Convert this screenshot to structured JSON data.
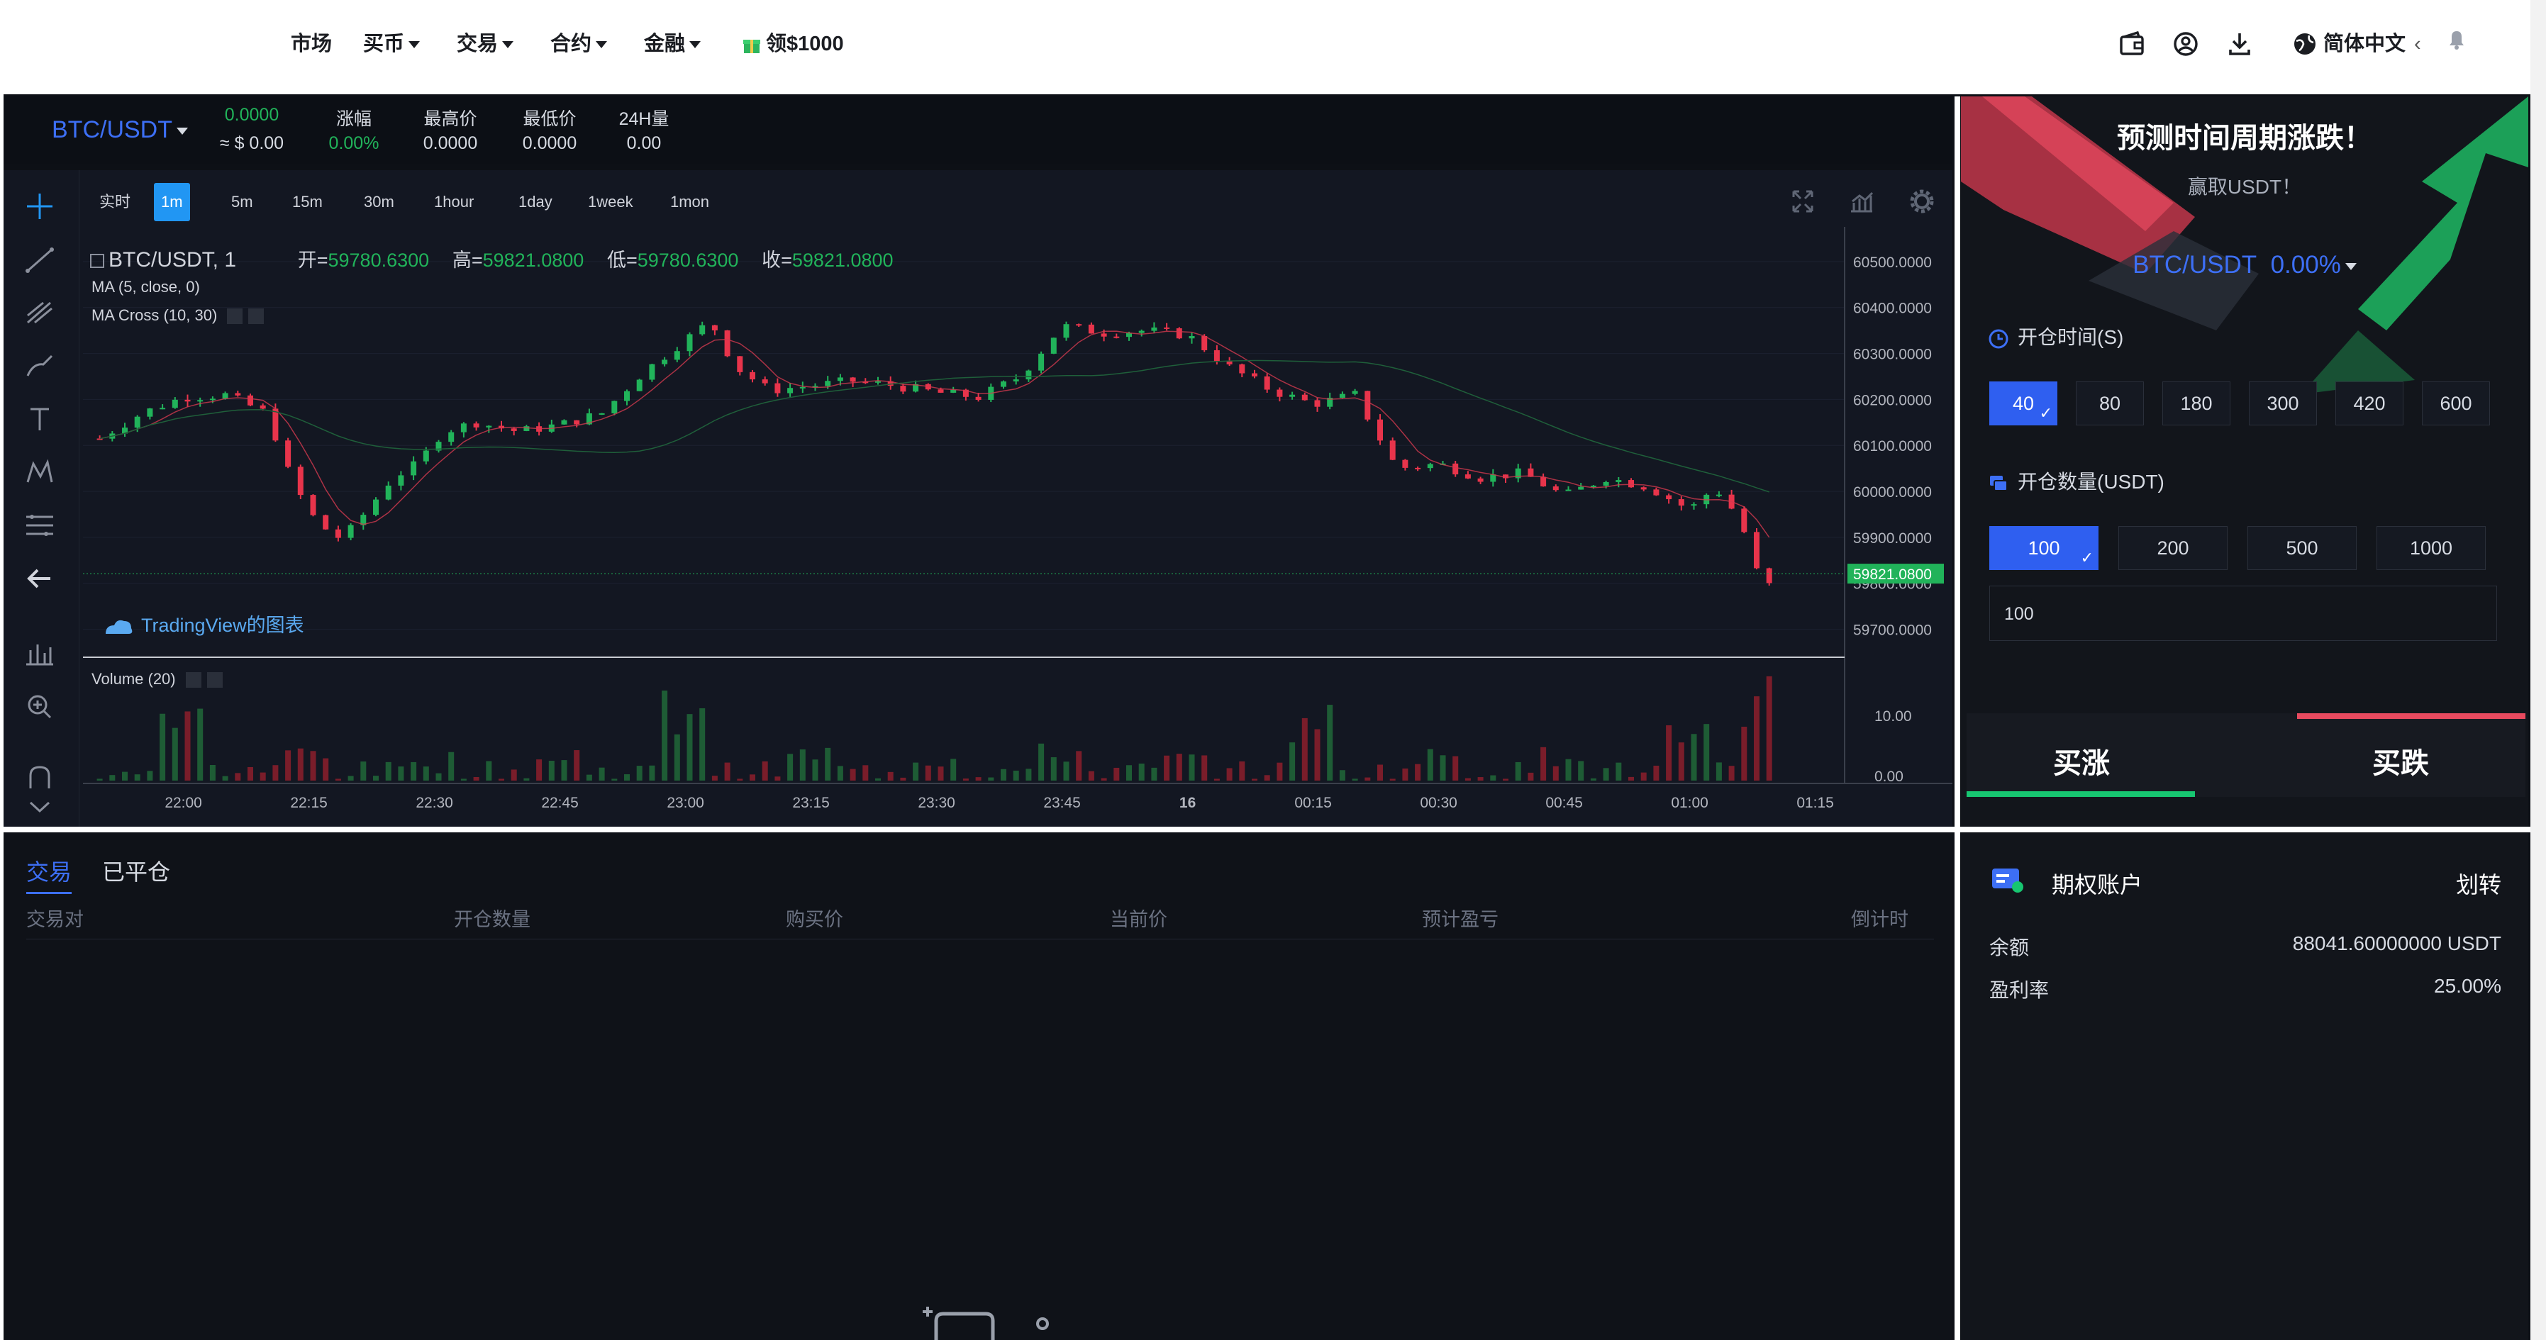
{
  "nav": {
    "items": [
      {
        "label": "市场",
        "dropdown": false
      },
      {
        "label": "买币",
        "dropdown": true
      },
      {
        "label": "交易",
        "dropdown": true
      },
      {
        "label": "合约",
        "dropdown": true
      },
      {
        "label": "金融",
        "dropdown": true
      }
    ],
    "promo_label": "领$1000",
    "language_label": "简体中文",
    "language_arrow": "‹",
    "icons": [
      "wallet-icon",
      "user-icon",
      "download-icon",
      "globe-icon",
      "bell-icon"
    ]
  },
  "ticker": {
    "pair": "BTC/USDT",
    "last_price": "0.0000",
    "last_price_usd": "≈ $ 0.00",
    "change_label": "涨幅",
    "change_value": "0.00%",
    "high_label": "最高价",
    "high_value": "0.0000",
    "low_label": "最低价",
    "low_value": "0.0000",
    "volume_label": "24H量",
    "volume_value": "0.00"
  },
  "chart": {
    "intervals": [
      "实时",
      "1m",
      "5m",
      "15m",
      "30m",
      "1hour",
      "1day",
      "1week",
      "1mon"
    ],
    "active_interval": "1m",
    "legend_symbol": "BTC/USDT, 1",
    "open_label": "开=",
    "open_value": "59780.6300",
    "high_label": "高=",
    "high_value": "59821.0800",
    "low_label": "低=",
    "low_value": "59780.6300",
    "close_label": "收=",
    "close_value": "59821.0800",
    "indicator_ma": "MA (5, close, 0)",
    "indicator_cross": "MA Cross (10, 30)",
    "volume_indicator": "Volume (20)",
    "watermark": "TradingView的图表",
    "current_price_tag": "59821.0800",
    "price_axis": [
      "60500.0000",
      "60400.0000",
      "60300.0000",
      "60200.0000",
      "60100.0000",
      "60000.0000",
      "59900.0000",
      "59800.0000",
      "59700.0000"
    ],
    "volume_axis": [
      "10.00",
      "0.00"
    ],
    "time_axis": [
      "22:00",
      "22:15",
      "22:30",
      "22:45",
      "23:00",
      "23:15",
      "23:30",
      "23:45",
      "16",
      "00:15",
      "00:30",
      "00:45",
      "01:00",
      "01:15"
    ],
    "colors": {
      "up": "#21b35a",
      "down": "#e8344b",
      "bg": "#131722"
    }
  },
  "chart_data": {
    "type": "candlestick",
    "title": "BTC/USDT, 1",
    "ylim": [
      59650,
      60560
    ],
    "x_tick_labels": [
      "22:00",
      "22:15",
      "22:30",
      "22:45",
      "23:00",
      "23:15",
      "23:30",
      "23:45",
      "16",
      "00:15",
      "00:30",
      "00:45",
      "01:00",
      "01:15"
    ],
    "close_series": [
      {
        "t": "21:50",
        "v": 60115
      },
      {
        "t": "21:55",
        "v": 60170
      },
      {
        "t": "22:00",
        "v": 60205
      },
      {
        "t": "22:05",
        "v": 60210
      },
      {
        "t": "22:10",
        "v": 60170
      },
      {
        "t": "22:13",
        "v": 60020
      },
      {
        "t": "22:16",
        "v": 59930
      },
      {
        "t": "22:19",
        "v": 59895
      },
      {
        "t": "22:22",
        "v": 59960
      },
      {
        "t": "22:25",
        "v": 60030
      },
      {
        "t": "22:28",
        "v": 60060
      },
      {
        "t": "22:31",
        "v": 60130
      },
      {
        "t": "22:35",
        "v": 60150
      },
      {
        "t": "22:40",
        "v": 60130
      },
      {
        "t": "22:45",
        "v": 60145
      },
      {
        "t": "22:50",
        "v": 60170
      },
      {
        "t": "22:55",
        "v": 60260
      },
      {
        "t": "23:00",
        "v": 60330
      },
      {
        "t": "23:03",
        "v": 60370
      },
      {
        "t": "23:06",
        "v": 60270
      },
      {
        "t": "23:10",
        "v": 60220
      },
      {
        "t": "23:15",
        "v": 60230
      },
      {
        "t": "23:20",
        "v": 60240
      },
      {
        "t": "23:25",
        "v": 60230
      },
      {
        "t": "23:30",
        "v": 60215
      },
      {
        "t": "23:35",
        "v": 60205
      },
      {
        "t": "23:40",
        "v": 60250
      },
      {
        "t": "23:45",
        "v": 60360
      },
      {
        "t": "23:50",
        "v": 60345
      },
      {
        "t": "23:55",
        "v": 60350
      },
      {
        "t": "00:00",
        "v": 60340
      },
      {
        "t": "00:05",
        "v": 60270
      },
      {
        "t": "00:10",
        "v": 60220
      },
      {
        "t": "00:15",
        "v": 60190
      },
      {
        "t": "00:20",
        "v": 60210
      },
      {
        "t": "00:25",
        "v": 60050
      },
      {
        "t": "00:30",
        "v": 60060
      },
      {
        "t": "00:35",
        "v": 60030
      },
      {
        "t": "00:40",
        "v": 60040
      },
      {
        "t": "00:45",
        "v": 59990
      },
      {
        "t": "00:50",
        "v": 60030
      },
      {
        "t": "00:55",
        "v": 60010
      },
      {
        "t": "01:00",
        "v": 59960
      },
      {
        "t": "01:03",
        "v": 60010
      },
      {
        "t": "01:06",
        "v": 59940
      },
      {
        "t": "01:09",
        "v": 59770
      },
      {
        "t": "01:10",
        "v": 59821
      }
    ],
    "volume_series": [
      {
        "t": "22:00",
        "v": 12
      },
      {
        "t": "22:15",
        "v": 4
      },
      {
        "t": "22:30",
        "v": 2
      },
      {
        "t": "22:45",
        "v": 3
      },
      {
        "t": "23:00",
        "v": 11
      },
      {
        "t": "23:15",
        "v": 3
      },
      {
        "t": "23:30",
        "v": 3
      },
      {
        "t": "23:45",
        "v": 3
      },
      {
        "t": "00:00",
        "v": 2
      },
      {
        "t": "00:15",
        "v": 10
      },
      {
        "t": "00:30",
        "v": 3
      },
      {
        "t": "00:45",
        "v": 3
      },
      {
        "t": "01:00",
        "v": 7
      },
      {
        "t": "01:08",
        "v": 15
      }
    ]
  },
  "positions": {
    "tabs": [
      "交易",
      "已平仓"
    ],
    "active_tab": 0,
    "columns": [
      "交易对",
      "开仓数量",
      "购买价",
      "当前价",
      "预计盈亏",
      "倒计时"
    ]
  },
  "trade": {
    "title": "预测时间周期涨跌！",
    "subtitle": "赢取USDT！",
    "pair": "BTC/USDT",
    "pair_change": "0.00%",
    "time_label": "开仓时间(S)",
    "time_options": [
      "40",
      "80",
      "180",
      "300",
      "420",
      "600"
    ],
    "time_selected": 0,
    "amount_label": "开仓数量(USDT)",
    "amount_options": [
      "100",
      "200",
      "500",
      "1000"
    ],
    "amount_selected": 0,
    "amount_input_value": "100",
    "buy_up_label": "买涨",
    "buy_down_label": "买跌",
    "colors": {
      "accent": "#2f5ff0",
      "up": "#17c671",
      "down": "#e84a5f"
    }
  },
  "account": {
    "title": "期权账户",
    "transfer_label": "划转",
    "balance_label": "余额",
    "balance_value": "88041.60000000 USDT",
    "profit_rate_label": "盈利率",
    "profit_rate_value": "25.00%"
  }
}
